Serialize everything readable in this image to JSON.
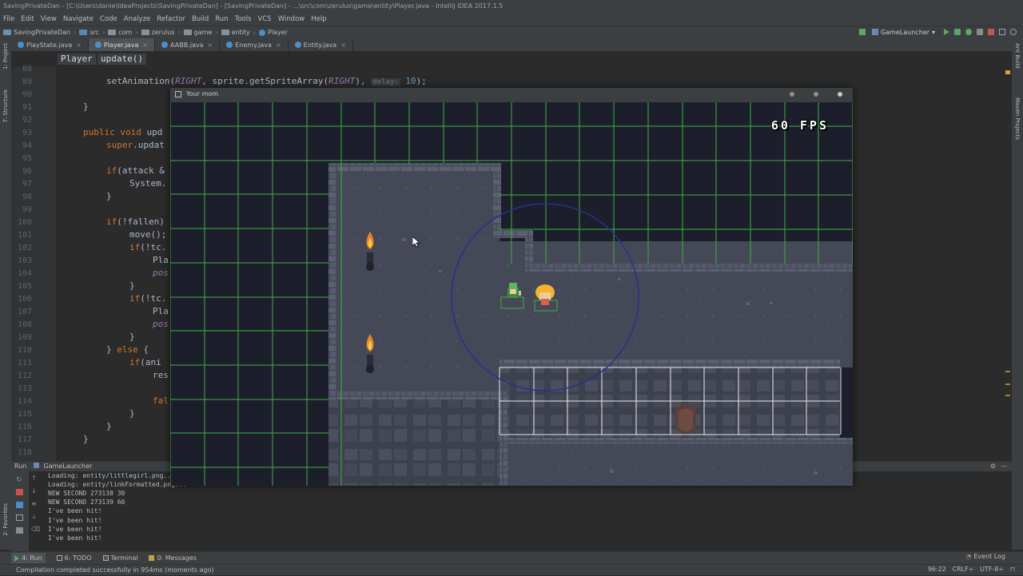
{
  "window": {
    "title": "SavingPrivateDan - [C:\\Users\\danie\\IdeaProjects\\SavingPrivateDan] - [SavingPrivateDan] - ...\\src\\com\\zerulus\\game\\entity\\Player.java - IntelliJ IDEA 2017.1.5"
  },
  "menu": [
    "File",
    "Edit",
    "View",
    "Navigate",
    "Code",
    "Analyze",
    "Refactor",
    "Build",
    "Run",
    "Tools",
    "VCS",
    "Window",
    "Help"
  ],
  "nav": {
    "crumbs": [
      "SavingPrivateDan",
      "src",
      "com",
      "zerulus",
      "game",
      "entity",
      "Player"
    ],
    "run_config": "GameLauncher"
  },
  "tabs": [
    {
      "label": "PlayState.java",
      "active": false
    },
    {
      "label": "Player.java",
      "active": true
    },
    {
      "label": "AABB.java",
      "active": false
    },
    {
      "label": "Enemy.java",
      "active": false
    },
    {
      "label": "Entity.java",
      "active": false
    }
  ],
  "side_labels": {
    "project": "1: Project",
    "structure": "7: Structure",
    "favorites": "2: Favorites",
    "ant": "Ant Build",
    "maven": "Maven Projects"
  },
  "editor": {
    "breadcrumb": [
      "Player",
      "update()"
    ],
    "line_numbers": [
      "88",
      "89",
      "90",
      "91",
      "92",
      "93",
      "94",
      "95",
      "96",
      "97",
      "98",
      "99",
      "100",
      "101",
      "102",
      "103",
      "104",
      "105",
      "106",
      "107",
      "108",
      "109",
      "110",
      "111",
      "112",
      "113",
      "114",
      "115",
      "116",
      "117",
      "118"
    ]
  },
  "game": {
    "title": "Your mom",
    "fps": "60 FPS"
  },
  "run": {
    "header": "Run",
    "config": "GameLauncher",
    "console": [
      "Loading: entity/littlegirl.png...",
      "Loading: entity/linkFormatted.png...",
      "NEW SECOND 273138 30",
      "NEW SECOND 273139 60",
      "I've been hit!",
      "I've been hit!",
      "I've been hit!",
      "I've been hit!"
    ]
  },
  "bottom_tabs": [
    "4: Run",
    "6: TODO",
    "Terminal",
    "0: Messages"
  ],
  "event_log": "Event Log",
  "status": {
    "message": "Compilation completed successfully in 954ms (moments ago)",
    "position": "96:22",
    "line_sep": "CRLF÷",
    "encoding": "UTF-8÷"
  }
}
